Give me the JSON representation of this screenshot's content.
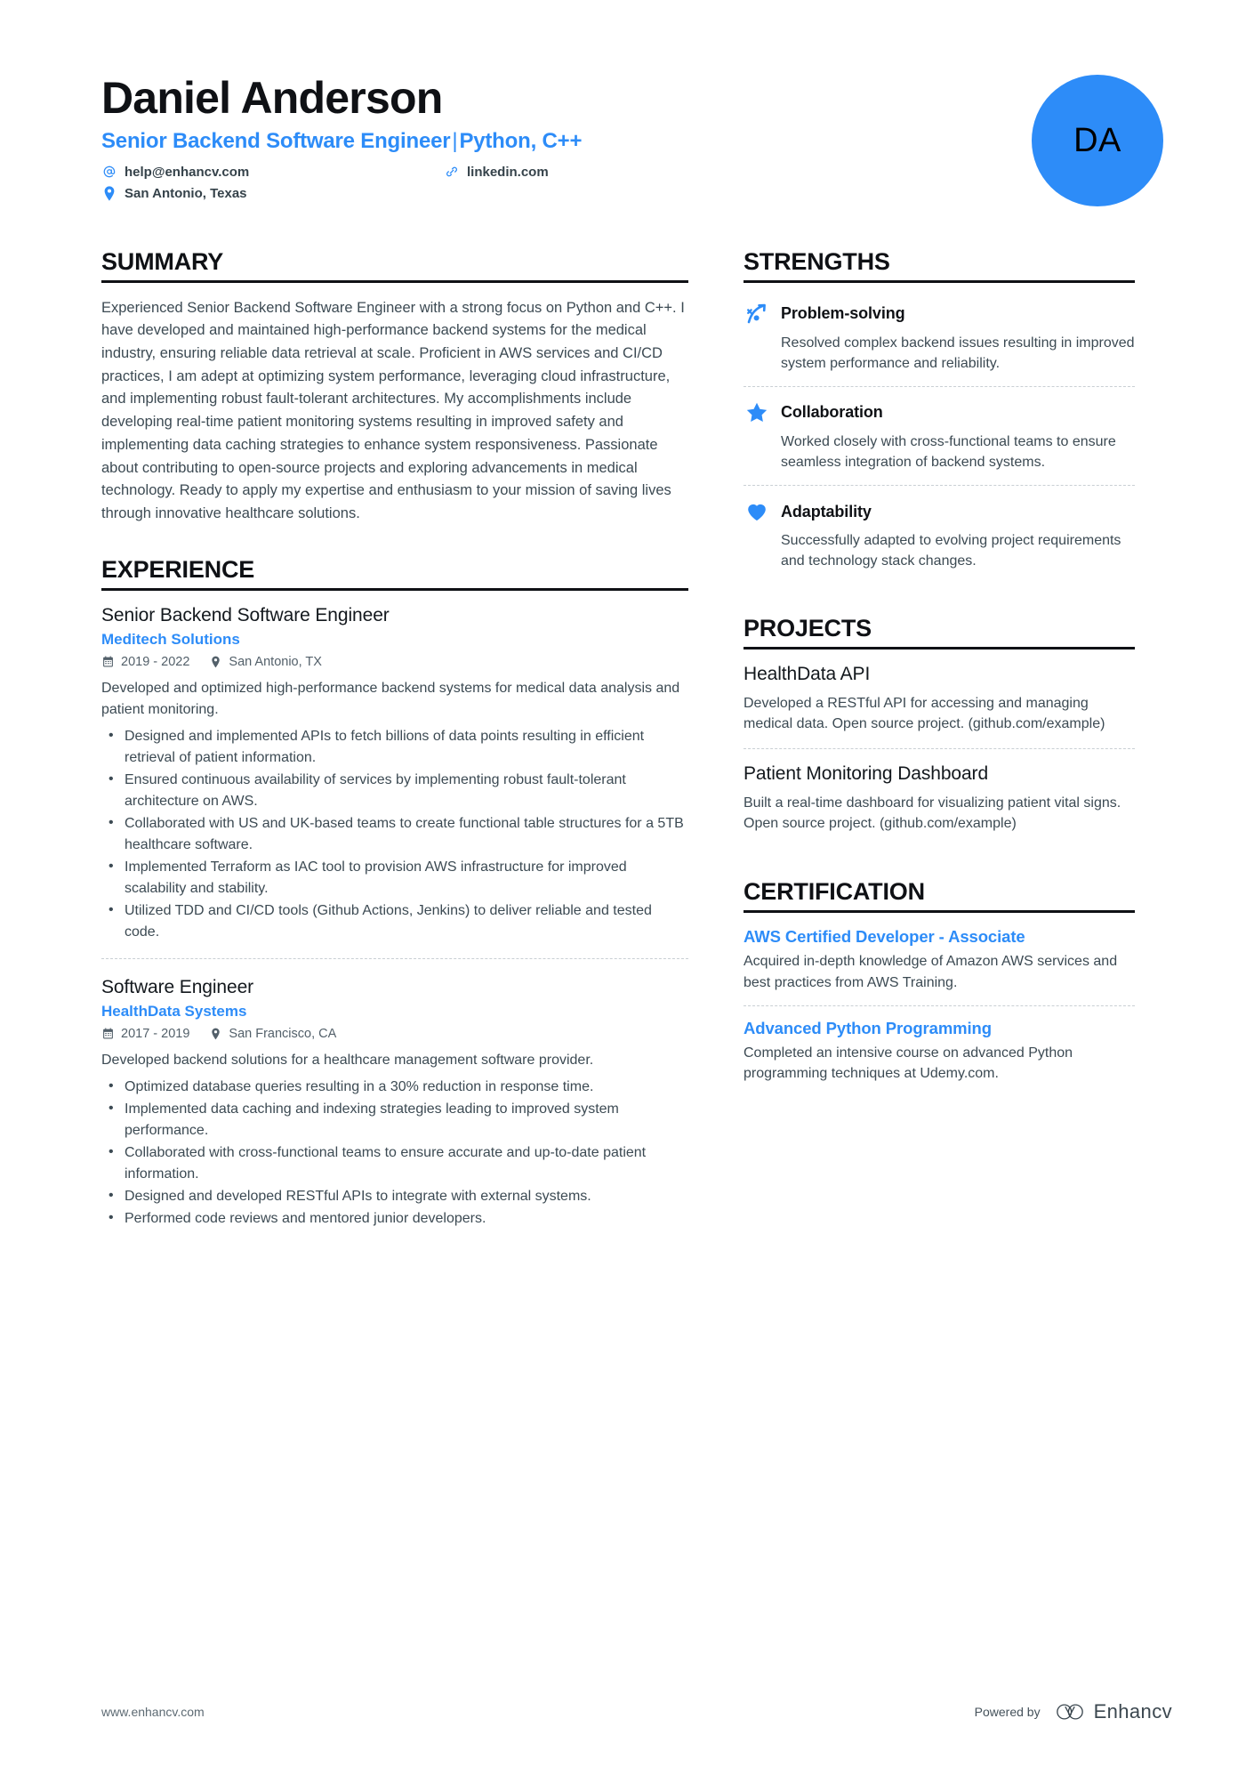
{
  "header": {
    "full_name": "Daniel Anderson",
    "job_title": "Senior Backend Software Engineer",
    "title_separator": "|",
    "job_title_tech": "Python, C++",
    "avatar_initials": "DA",
    "contacts": {
      "email": "help@enhancv.com",
      "linkedin": "linkedin.com",
      "location": "San Antonio, Texas"
    },
    "icons": {
      "email": "at-sign-icon",
      "linkedin": "link-icon",
      "location": "map-pin-icon"
    }
  },
  "accent_color": "#2d8cf8",
  "summary": {
    "title": "SUMMARY",
    "text": "Experienced Senior Backend Software Engineer with a strong focus on Python and C++. I have developed and maintained high-performance backend systems for the medical industry, ensuring reliable data retrieval at scale. Proficient in AWS services and CI/CD practices, I am adept at optimizing system performance, leveraging cloud infrastructure, and implementing robust fault-tolerant architectures. My accomplishments include developing real-time patient monitoring systems resulting in improved safety and implementing data caching strategies to enhance system responsiveness. Passionate about contributing to open-source projects and exploring advancements in medical technology. Ready to apply my expertise and enthusiasm to your mission of saving lives through innovative healthcare solutions."
  },
  "experience": {
    "title": "EXPERIENCE",
    "entries": [
      {
        "role": "Senior Backend Software Engineer",
        "company": "Meditech Solutions",
        "dates": "2019 - 2022",
        "location": "San Antonio, TX",
        "description": "Developed and optimized high-performance backend systems for medical data analysis and patient monitoring.",
        "bullets": [
          "Designed and implemented APIs to fetch billions of data points resulting in efficient retrieval of patient information.",
          "Ensured continuous availability of services by implementing robust fault-tolerant architecture on AWS.",
          "Collaborated with US and UK-based teams to create functional table structures for a 5TB healthcare software.",
          "Implemented Terraform as IAC tool to provision AWS infrastructure for improved scalability and stability.",
          "Utilized TDD and CI/CD tools (Github Actions, Jenkins) to deliver reliable and tested code."
        ]
      },
      {
        "role": "Software Engineer",
        "company": "HealthData Systems",
        "dates": "2017 - 2019",
        "location": "San Francisco, CA",
        "description": "Developed backend solutions for a healthcare management software provider.",
        "bullets": [
          "Optimized database queries resulting in a 30% reduction in response time.",
          "Implemented data caching and indexing strategies leading to improved system performance.",
          "Collaborated with cross-functional teams to ensure accurate and up-to-date patient information.",
          "Designed and developed RESTful APIs to integrate with external systems.",
          "Performed code reviews and mentored junior developers."
        ]
      }
    ]
  },
  "strengths": {
    "title": "STRENGTHS",
    "items": [
      {
        "icon": "trajectory-arrow-icon",
        "name": "Problem-solving",
        "description": "Resolved complex backend issues resulting in improved system performance and reliability."
      },
      {
        "icon": "star-icon",
        "name": "Collaboration",
        "description": "Worked closely with cross-functional teams to ensure seamless integration of backend systems."
      },
      {
        "icon": "heart-icon",
        "name": "Adaptability",
        "description": "Successfully adapted to evolving project requirements and technology stack changes."
      }
    ]
  },
  "projects": {
    "title": "PROJECTS",
    "items": [
      {
        "name": "HealthData API",
        "description": "Developed a RESTful API for accessing and managing medical data. Open source project. (github.com/example)"
      },
      {
        "name": "Patient Monitoring Dashboard",
        "description": "Built a real-time dashboard for visualizing patient vital signs. Open source project. (github.com/example)"
      }
    ]
  },
  "certification": {
    "title": "CERTIFICATION",
    "items": [
      {
        "name": "AWS Certified Developer - Associate",
        "description": "Acquired in-depth knowledge of Amazon AWS services and best practices from AWS Training."
      },
      {
        "name": "Advanced Python Programming",
        "description": "Completed an intensive course on advanced Python programming techniques at Udemy.com."
      }
    ]
  },
  "footer": {
    "url": "www.enhancv.com",
    "powered_by": "Powered by",
    "brand_name": "Enhancv",
    "brand_mark": "enhancv-logo-icon"
  }
}
